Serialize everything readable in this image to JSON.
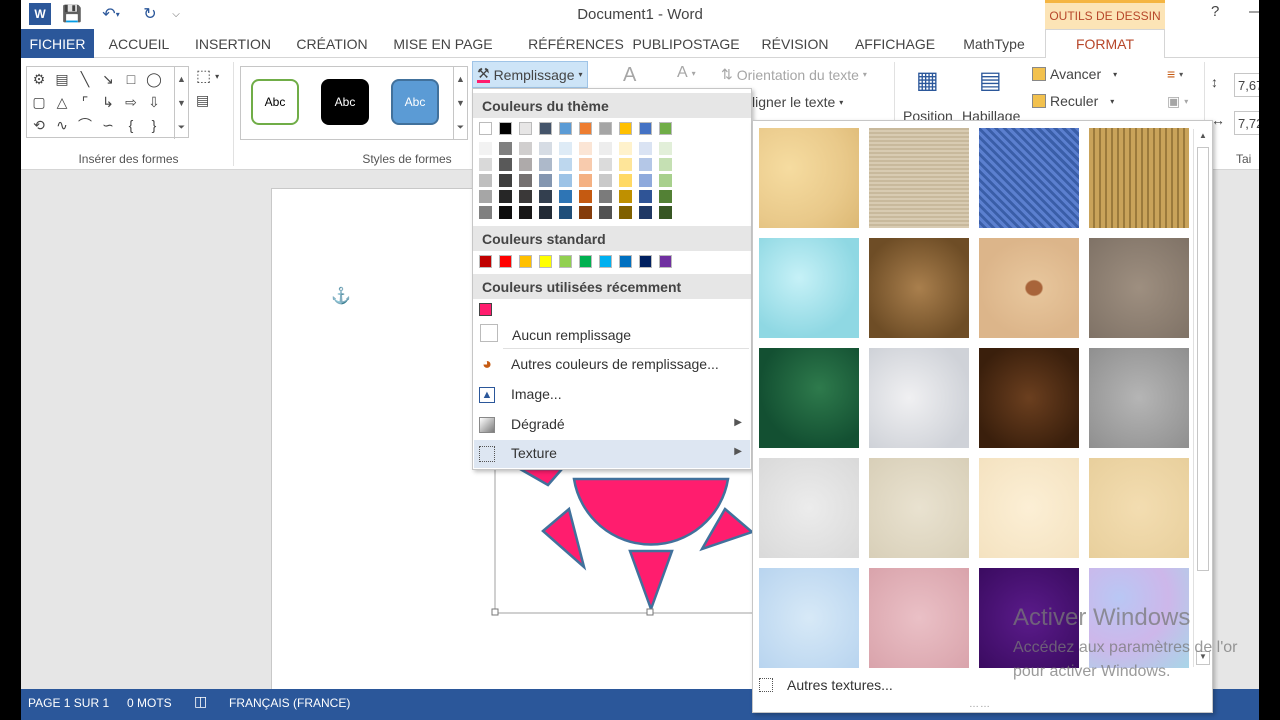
{
  "title_bar": {
    "doc_title": "Document1 - Word",
    "contextual_tab": "OUTILS DE DESSIN",
    "help": "?"
  },
  "tabs": [
    "FICHIER",
    "ACCUEIL",
    "INSERTION",
    "CRÉATION",
    "MISE EN PAGE",
    "RÉFÉRENCES",
    "PUBLIPOSTAGE",
    "RÉVISION",
    "AFFICHAGE",
    "MathType",
    "FORMAT"
  ],
  "ribbon": {
    "group_insert_shapes": "Insérer des formes",
    "group_shape_styles": "Styles de formes",
    "style_samples": [
      "Abc",
      "Abc",
      "Abc"
    ],
    "fill_button": "Remplissage",
    "text_direction": "Orientation du texte",
    "align_text": "ligner le texte",
    "position": "Position",
    "wrap": "Habillage",
    "bring_forward": "Avancer",
    "send_backward": "Reculer",
    "size_height": "7,67",
    "size_width": "7,72",
    "size_group_partial": "Tai"
  },
  "fill_menu": {
    "theme_colors_header": "Couleurs du thème",
    "standard_colors_header": "Couleurs standard",
    "recent_colors_header": "Couleurs utilisées récemment",
    "no_fill": "Aucun remplissage",
    "more_colors": "Autres couleurs de remplissage...",
    "picture": "Image...",
    "gradient": "Dégradé",
    "texture": "Texture",
    "theme_top": [
      "#ffffff",
      "#000000",
      "#e7e6e6",
      "#44546a",
      "#5b9bd5",
      "#ed7d31",
      "#a5a5a5",
      "#ffc000",
      "#4472c4",
      "#70ad47"
    ],
    "theme_shades": [
      [
        "#f2f2f2",
        "#d9d9d9",
        "#bfbfbf",
        "#a6a6a6",
        "#808080"
      ],
      [
        "#7f7f7f",
        "#595959",
        "#3f3f3f",
        "#262626",
        "#0d0d0d"
      ],
      [
        "#d0cece",
        "#aeaaaa",
        "#757171",
        "#3a3838",
        "#171616"
      ],
      [
        "#d6dce4",
        "#adb9ca",
        "#8496b0",
        "#333f4f",
        "#222a35"
      ],
      [
        "#deebf6",
        "#bdd7ee",
        "#9dc3e6",
        "#2e75b5",
        "#1f4e79"
      ],
      [
        "#fbe5d5",
        "#f8cbad",
        "#f4b183",
        "#c55a11",
        "#843c0b"
      ],
      [
        "#ededed",
        "#dbdbdb",
        "#c9c9c9",
        "#7b7b7b",
        "#525252"
      ],
      [
        "#fff2cc",
        "#fee599",
        "#ffd965",
        "#bf9000",
        "#7f6000"
      ],
      [
        "#dae3f3",
        "#b4c7e7",
        "#8faadc",
        "#2f5496",
        "#1f3864"
      ],
      [
        "#e2efd9",
        "#c5e0b3",
        "#a8d08d",
        "#538135",
        "#375623"
      ]
    ],
    "standard": [
      "#c00000",
      "#ff0000",
      "#ffc000",
      "#ffff00",
      "#92d050",
      "#00b050",
      "#00b0f0",
      "#0070c0",
      "#002060",
      "#7030a0"
    ],
    "recent": [
      "#ff1d6e"
    ]
  },
  "texture_panel": {
    "more_textures": "Autres textures...",
    "textures": [
      "papyrus",
      "canvas",
      "denim",
      "woven-mat",
      "water-droplets",
      "paper-bag",
      "fish-fossil",
      "sand",
      "green-marble",
      "white-marble",
      "brown-marble",
      "granite",
      "newsprint",
      "recycled-paper",
      "parchment",
      "stationery",
      "blue-tissue-paper",
      "pink-tissue-paper",
      "purple-mesh",
      "bouquet"
    ]
  },
  "status_bar": {
    "page": "PAGE 1 SUR 1",
    "words": "0 MOTS",
    "language": "FRANÇAIS (FRANCE)"
  },
  "watermark": {
    "line1": "Activer Windows",
    "line2": "Accédez aux paramètres de l'or",
    "line3": "pour activer Windows."
  },
  "colors": {
    "word_blue": "#2b579a",
    "shape_fill": "#ff1d6e",
    "shape_outline": "#41719c",
    "context_tab_accent": "#b7472a"
  }
}
